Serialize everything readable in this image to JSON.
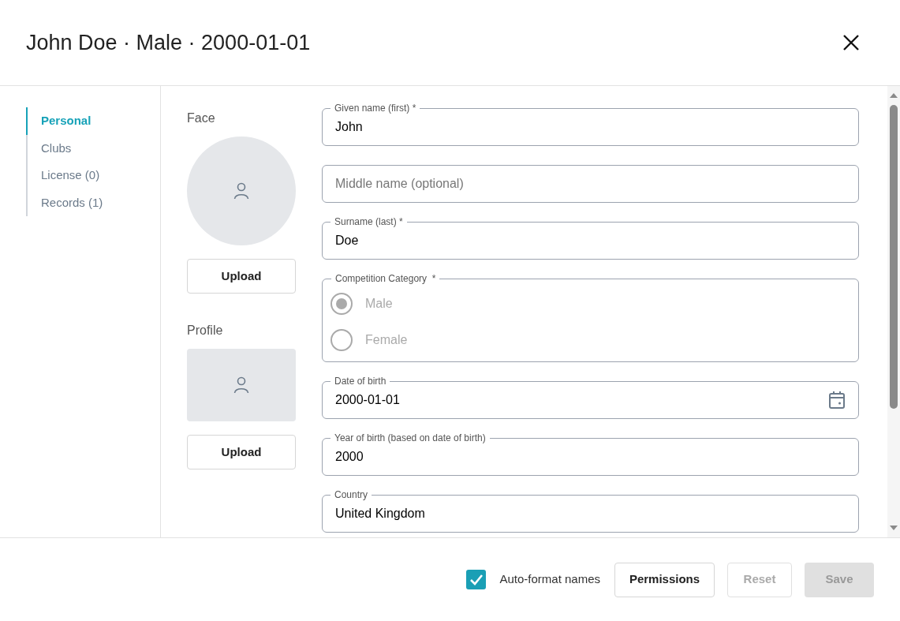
{
  "dialog": {
    "title": "John Doe · Male · 2000-01-01"
  },
  "nav": [
    {
      "label": "Personal",
      "selected": true
    },
    {
      "label": "Clubs",
      "selected": false
    },
    {
      "label": "License (0)",
      "selected": false
    },
    {
      "label": "Records (1)",
      "selected": false
    }
  ],
  "media": [
    {
      "label": "Face",
      "kind": "round",
      "button": "Upload"
    },
    {
      "label": "Profile",
      "kind": "square",
      "button": "Upload"
    }
  ],
  "fields": [
    {
      "kind": "text",
      "label": "Given name (first) *",
      "value": "John"
    },
    {
      "kind": "text",
      "placeholder": "Middle name (optional)"
    },
    {
      "kind": "text",
      "label": "Surname (last) *",
      "value": "Doe"
    },
    {
      "kind": "radio",
      "label": "Competition Category  *",
      "disabled": true,
      "options": [
        {
          "label": "Male",
          "selected": true
        },
        {
          "label": "Female",
          "selected": false
        }
      ]
    },
    {
      "kind": "date",
      "label": "Date of birth",
      "value": "2000-01-01"
    },
    {
      "kind": "text",
      "label": "Year of birth (based on date of birth)",
      "value": "2000"
    },
    {
      "kind": "select",
      "label": "Country",
      "value": "United Kingdom"
    }
  ],
  "footer": {
    "auto_format": {
      "label": "Auto-format names",
      "checked": true
    },
    "buttons": [
      {
        "label": "Permissions",
        "disabled": false
      },
      {
        "label": "Reset",
        "disabled": true
      },
      {
        "label": "Save",
        "disabled": true,
        "kind": "filled"
      }
    ]
  }
}
